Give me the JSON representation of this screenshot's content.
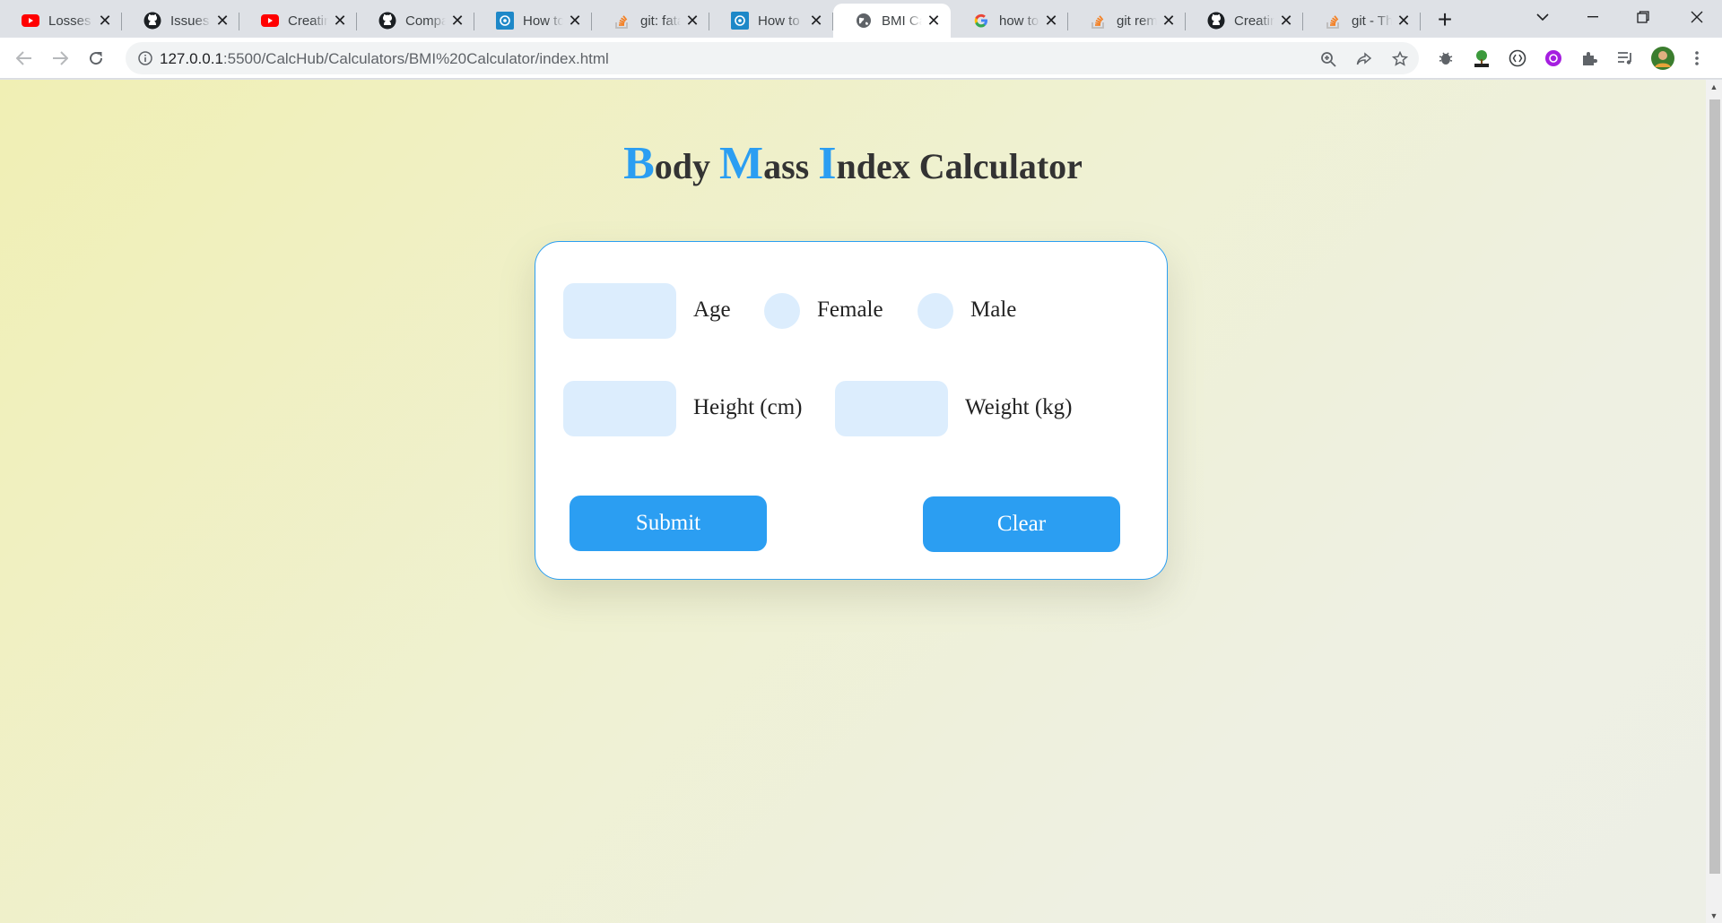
{
  "browser": {
    "tabs": [
      {
        "title": "Losses | ",
        "favicon": "youtube-icon"
      },
      {
        "title": "Issues · ",
        "favicon": "github-icon"
      },
      {
        "title": "Creating ",
        "favicon": "youtube-icon"
      },
      {
        "title": "Compar",
        "favicon": "github-icon"
      },
      {
        "title": "How to",
        "favicon": "site-icon"
      },
      {
        "title": "git: fata",
        "favicon": "stackoverflow-icon"
      },
      {
        "title": "How to",
        "favicon": "site-icon"
      },
      {
        "title": "BMI Cal",
        "favicon": "globe-icon",
        "active": true
      },
      {
        "title": "how to",
        "favicon": "google-icon"
      },
      {
        "title": "git rem",
        "favicon": "stackoverflow-icon"
      },
      {
        "title": "Creatin",
        "favicon": "github-icon"
      },
      {
        "title": "git - Th",
        "favicon": "stackoverflow-icon"
      }
    ],
    "new_tab": "+",
    "url_host": "127.0.0.1",
    "url_rest": ":5500/CalcHub/Calculators/BMI%20Calculator/index.html"
  },
  "page": {
    "title_parts": [
      {
        "cap": "B",
        "rest": "ody "
      },
      {
        "cap": "M",
        "rest": "ass "
      },
      {
        "cap": "I",
        "rest": "ndex Calculator"
      }
    ],
    "age_label": "Age",
    "female_label": "Female",
    "male_label": "Male",
    "height_label": "Height (cm)",
    "weight_label": "Weight (kg)",
    "submit_label": "Submit",
    "clear_label": "Clear",
    "age_value": "",
    "height_value": "",
    "weight_value": ""
  },
  "colors": {
    "accent": "#2b9ef2",
    "field_bg": "#dcedfd",
    "page_bg_start": "#f0efb4",
    "page_bg_end": "#edefe6"
  }
}
